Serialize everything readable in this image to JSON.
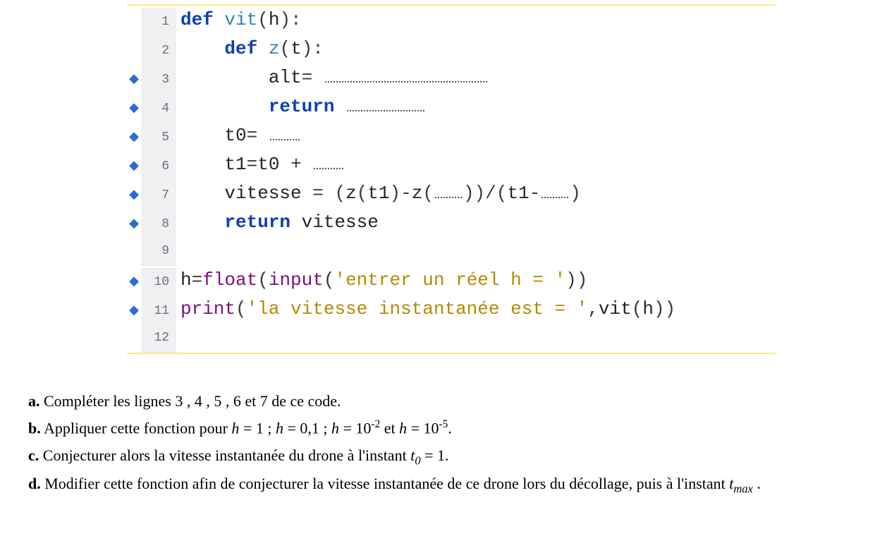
{
  "code": {
    "lines": [
      {
        "n": "1",
        "bp": "",
        "tokens": [
          [
            "kw",
            "def "
          ],
          [
            "fn",
            "vit"
          ],
          [
            "op",
            "("
          ],
          [
            "id",
            "h"
          ],
          [
            "op",
            "):"
          ]
        ]
      },
      {
        "n": "2",
        "bp": "",
        "tokens": [
          [
            "",
            "    "
          ],
          [
            "kw",
            "def "
          ],
          [
            "fn",
            "z"
          ],
          [
            "op",
            "("
          ],
          [
            "id",
            "t"
          ],
          [
            "op",
            "):"
          ]
        ]
      },
      {
        "n": "3",
        "bp": "◆",
        "tokens": [
          [
            "",
            "        "
          ],
          [
            "id",
            "alt"
          ],
          [
            "op",
            "= "
          ],
          [
            "blank",
            "w200"
          ]
        ]
      },
      {
        "n": "4",
        "bp": "◆",
        "tokens": [
          [
            "",
            "        "
          ],
          [
            "kw",
            "return "
          ],
          [
            "blank",
            "w100"
          ]
        ]
      },
      {
        "n": "5",
        "bp": "◆",
        "tokens": [
          [
            "",
            "    "
          ],
          [
            "id",
            "t0"
          ],
          [
            "op",
            "= "
          ],
          [
            "blank",
            "w40"
          ]
        ]
      },
      {
        "n": "6",
        "bp": "◆",
        "tokens": [
          [
            "",
            "    "
          ],
          [
            "id",
            "t1"
          ],
          [
            "op",
            "="
          ],
          [
            "id",
            "t0"
          ],
          [
            "op",
            " + "
          ],
          [
            "blank",
            "w40"
          ]
        ]
      },
      {
        "n": "7",
        "bp": "◆",
        "tokens": [
          [
            "",
            "    "
          ],
          [
            "id",
            "vitesse"
          ],
          [
            "op",
            " = ("
          ],
          [
            "id",
            "z"
          ],
          [
            "op",
            "("
          ],
          [
            "id",
            "t1"
          ],
          [
            "op",
            ")-"
          ],
          [
            "id",
            "z"
          ],
          [
            "op",
            "("
          ],
          [
            "blank",
            "w30"
          ],
          [
            "op",
            "))/("
          ],
          [
            "id",
            "t1"
          ],
          [
            "op",
            "-"
          ],
          [
            "blank",
            "w30"
          ],
          [
            "op",
            ")"
          ]
        ]
      },
      {
        "n": "8",
        "bp": "◆",
        "tokens": [
          [
            "",
            "    "
          ],
          [
            "kw",
            "return "
          ],
          [
            "id",
            "vitesse"
          ]
        ]
      },
      {
        "n": "9",
        "bp": "",
        "tokens": []
      },
      {
        "n": "10",
        "bp": "◆",
        "tokens": [
          [
            "id",
            "h"
          ],
          [
            "op",
            "="
          ],
          [
            "bi",
            "float"
          ],
          [
            "op",
            "("
          ],
          [
            "bi",
            "input"
          ],
          [
            "op",
            "("
          ],
          [
            "str",
            "'entrer un réel h = '"
          ],
          [
            "op",
            "))"
          ]
        ]
      },
      {
        "n": "11",
        "bp": "◆",
        "tokens": [
          [
            "bi",
            "print"
          ],
          [
            "op",
            "("
          ],
          [
            "str",
            "'la vitesse instantanée est = '"
          ],
          [
            "op",
            ","
          ],
          [
            "id",
            "vit"
          ],
          [
            "op",
            "("
          ],
          [
            "id",
            "h"
          ],
          [
            "op",
            "))"
          ]
        ]
      },
      {
        "n": "12",
        "bp": "",
        "tokens": []
      }
    ]
  },
  "questions": {
    "a": {
      "label": "a.",
      "text": " Compléter les lignes  3 , 4 , 5 , 6 et 7 de ce code."
    },
    "b": {
      "label": "b.",
      "pre": " Appliquer cette fonction pour ",
      "h1": "h",
      "eq1": " = 1 ; ",
      "h2": "h",
      "eq2": " = 0,1 ;  ",
      "h3": "h",
      "eq3_pre": " = 10",
      "eq3_sup": "-2",
      "eq3_post": "  et  ",
      "h4": "h",
      "eq4_pre": " = 10",
      "eq4_sup": "-5",
      "period": "."
    },
    "c": {
      "label": "c.",
      "pre": " Conjecturer alors la vitesse instantanée du drone à l'instant  ",
      "t": "t",
      "sub": "0",
      "post": " = 1."
    },
    "d": {
      "label": "d.",
      "pre": " Modifier cette fonction afin de conjecturer la vitesse instantanée de ce drone lors du décollage, puis à l'instant ",
      "t": "t",
      "sub": "max",
      "post": "  ."
    }
  }
}
